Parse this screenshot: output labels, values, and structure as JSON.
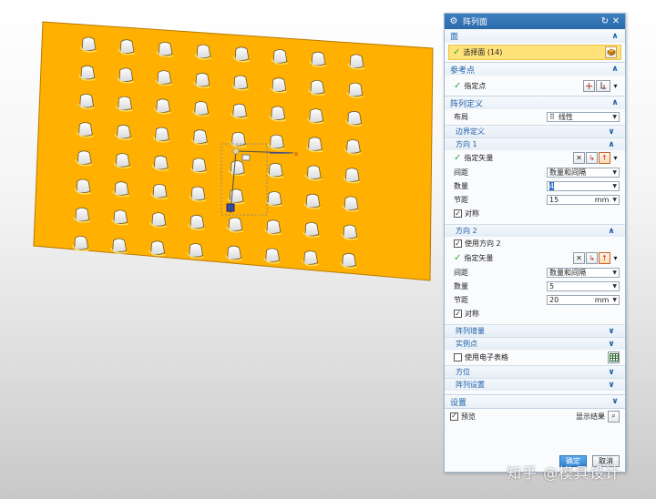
{
  "dialog": {
    "title": "阵列面",
    "groups": {
      "face": {
        "label": "面",
        "select_label": "选择面 (14)"
      },
      "ref_point": {
        "label": "参考点",
        "specify_label": "指定点"
      },
      "array_def": {
        "label": "阵列定义",
        "layout_label": "布局",
        "layout_value": "线性",
        "boundary_label": "边界定义",
        "dir1": {
          "label": "方向 1",
          "vector_label": "指定矢量",
          "spacing_label": "间距",
          "spacing_value": "数量和间隔",
          "count_label": "数量",
          "count_value": "4",
          "pitch_label": "节距",
          "pitch_value": "15",
          "pitch_unit": "mm",
          "symmetric_label": "对称"
        },
        "dir2": {
          "label": "方向 2",
          "use_label": "使用方向 2",
          "vector_label": "指定矢量",
          "spacing_label": "间距",
          "spacing_value": "数量和间隔",
          "count_label": "数量",
          "count_value": "5",
          "pitch_label": "节距",
          "pitch_value": "20",
          "pitch_unit": "mm",
          "symmetric_label": "对称"
        },
        "increment_label": "阵列增量",
        "instance_label": "实例点",
        "spreadsheet_label": "使用电子表格",
        "orientation_label": "方位",
        "settings_label": "阵列设置"
      },
      "settings": {
        "label": "设置"
      }
    },
    "preview_label": "预览",
    "show_result_label": "显示结果",
    "ok_label": "确定",
    "cancel_label": "取消"
  },
  "watermark": "知乎 @模具设计",
  "colors": {
    "plate": "#ffb000",
    "title_bar": "#3176b9",
    "group_text": "#1b5fa8",
    "selection": "#ffe27a"
  }
}
